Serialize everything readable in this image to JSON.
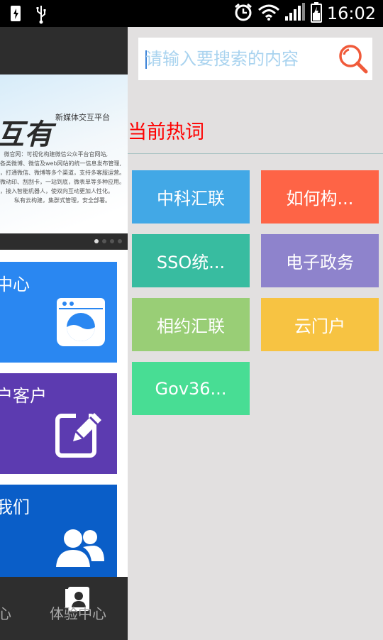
{
  "status_bar": {
    "time": "16:02",
    "icons": [
      "usb-charging-icon",
      "usb-icon",
      "alarm-icon",
      "wifi-icon",
      "signal-icon",
      "battery-charging-icon"
    ]
  },
  "background_app": {
    "banner": {
      "title": "互有",
      "subtitle": "新媒体交互平台",
      "lines": [
        "微官网：可视化构建微信公众平台官网站,",
        "各类微博、微信及web网站的统一信息发布管理,",
        "，打通微信、微博等多个渠道，支持多客服运营。",
        "微动印、刮刮卡，一站到底，微表单等多种应用。",
        "，接入智能机器人，使双向互动更加人性化。",
        "私有云构建，集群式管理，安全部署。"
      ],
      "page_dots": 4,
      "active_dot": 0
    },
    "tiles": [
      {
        "label": "中心",
        "color": "#2a87f1",
        "icon": "washing-machine-icon"
      },
      {
        "label": "户客户",
        "color": "#5c3bb0",
        "icon": "edit-pencil-icon"
      },
      {
        "label": "我们",
        "color": "#0a5ec8",
        "icon": "users-icon"
      }
    ],
    "bottom_nav": {
      "item_left_label": "心",
      "item_right_label": "体验中心",
      "item_right_icon": "contact-card-icon"
    }
  },
  "search": {
    "placeholder": "请输入要搜索的内容",
    "value": "",
    "button_icon": "search-icon",
    "accent": "#f05a3a"
  },
  "hot_words": {
    "title": "当前热词",
    "title_color": "#fe0000",
    "tags": [
      {
        "label": "中科汇联",
        "color": "#42a8e6"
      },
      {
        "label": "如何构...",
        "color": "#fe6446"
      },
      {
        "label": "SSO统...",
        "color": "#38bca0"
      },
      {
        "label": "电子政务",
        "color": "#8e83cc"
      },
      {
        "label": "相约汇联",
        "color": "#99ce76"
      },
      {
        "label": "云门户",
        "color": "#f7c342"
      },
      {
        "label": "Gov36...",
        "color": "#48dd94"
      }
    ]
  }
}
